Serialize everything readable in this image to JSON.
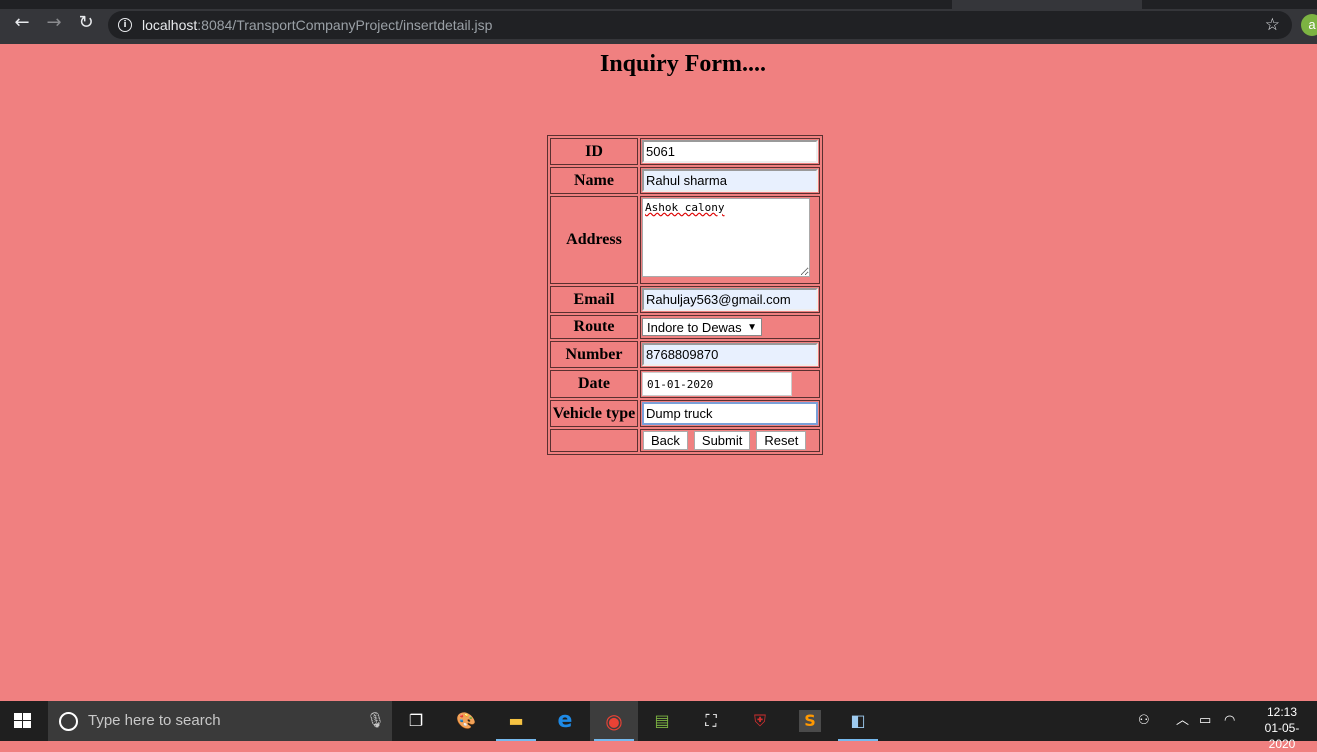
{
  "browser": {
    "url_host": "localhost",
    "url_path": ":8084/TransportCompanyProject/insertdetail.jsp",
    "profile_initial": "a",
    "icons": [
      "back-icon",
      "forward-icon",
      "reload-icon",
      "info-icon",
      "star-icon"
    ]
  },
  "page": {
    "title": "Inquiry Form....",
    "background": "#f08080"
  },
  "form": {
    "id": {
      "label": "ID",
      "value": "5061"
    },
    "name": {
      "label": "Name",
      "value": "Rahul sharma"
    },
    "address": {
      "label": "Address",
      "value": "Ashok calony"
    },
    "email": {
      "label": "Email",
      "value": "Rahuljay563@gmail.com"
    },
    "route": {
      "label": "Route",
      "value": "Indore to Dewas"
    },
    "number": {
      "label": "Number",
      "value": "8768809870"
    },
    "date": {
      "label": "Date",
      "value": "01-01-2020"
    },
    "vehicle": {
      "label": "Vehicle type",
      "value": "Dump truck"
    },
    "buttons": {
      "back": "Back",
      "submit": "Submit",
      "reset": "Reset"
    }
  },
  "taskbar": {
    "search_placeholder": "Type here to search",
    "time": "12:13",
    "date": "01-05-2020"
  }
}
